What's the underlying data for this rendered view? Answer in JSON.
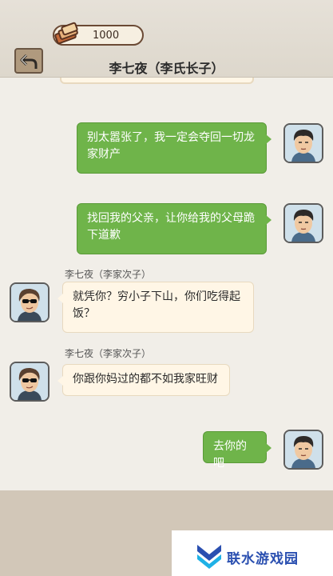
{
  "header": {
    "coins": "1000",
    "title": "李七夜（李氏长子）"
  },
  "messages": [
    {
      "side": "right",
      "text": "别太嚣张了，我一定会夺回一切龙家财产"
    },
    {
      "side": "right",
      "text": "找回我的父亲，让你给我的父母跪下道歉"
    },
    {
      "side": "left",
      "sender": "李七夜（李家次子）",
      "text": "就凭你？穷小子下山，你们吃得起饭？"
    },
    {
      "side": "left",
      "sender": "李七夜（李家次子）",
      "text": "你跟你妈过的都不如我家旺财"
    },
    {
      "side": "right",
      "text": "去你的吧"
    }
  ],
  "watermark": "联水游戏园",
  "colors": {
    "right_bubble": "#6fb44a",
    "left_bubble": "#fff6e6",
    "header_bg": "#e3ded4",
    "bottom_bg": "#d2c7b8"
  }
}
